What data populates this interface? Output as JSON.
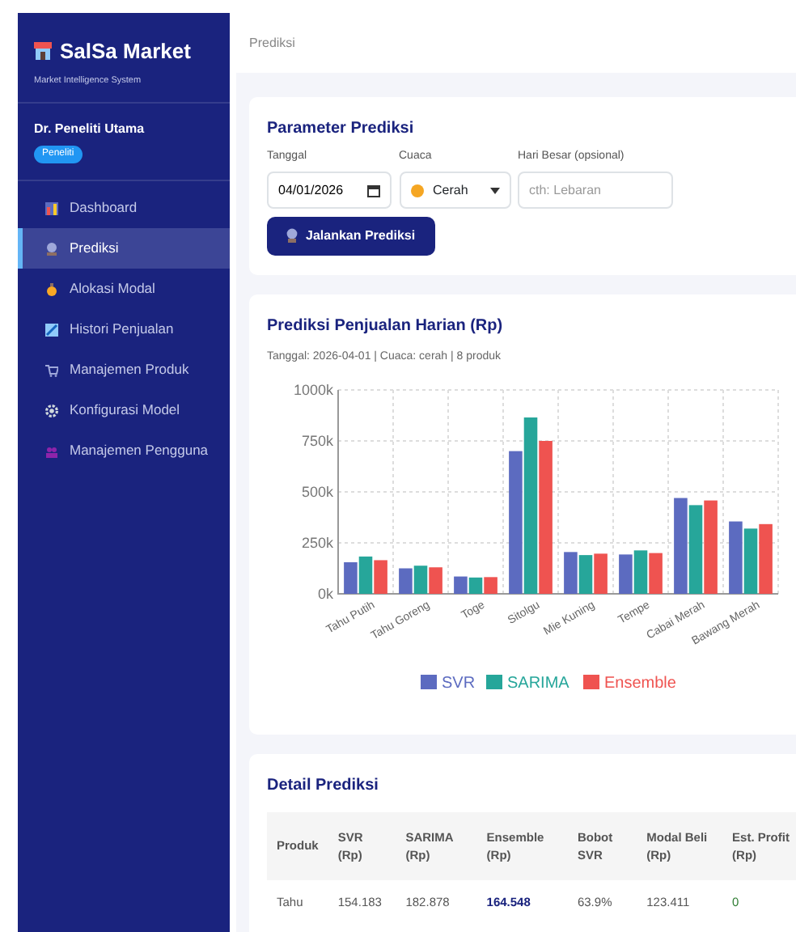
{
  "sidebar": {
    "brand": "SalSa Market",
    "tagline": "Market Intelligence System",
    "user": {
      "name": "Dr. Peneliti Utama",
      "role": "Peneliti"
    },
    "items": [
      {
        "label": "Dashboard",
        "selected": false
      },
      {
        "label": "Prediksi",
        "selected": true
      },
      {
        "label": "Alokasi Modal",
        "selected": false
      },
      {
        "label": "Histori Penjualan",
        "selected": false
      },
      {
        "label": "Manajemen Produk",
        "selected": false
      },
      {
        "label": "Konfigurasi Model",
        "selected": false
      },
      {
        "label": "Manajemen Pengguna",
        "selected": false
      }
    ]
  },
  "header": {
    "title": "Prediksi"
  },
  "parameters": {
    "title": "Parameter Prediksi",
    "date": {
      "label": "Tanggal",
      "value": "04/01/2026"
    },
    "weather": {
      "label": "Cuaca",
      "value": "Cerah"
    },
    "holiday": {
      "label": "Hari Besar (opsional)",
      "placeholder": "cth: Lebaran"
    },
    "button": "Jalankan Prediksi"
  },
  "forecast": {
    "title": "Prediksi Penjualan Harian (Rp)",
    "subtitle": "Tanggal: 2026-04-01 | Cuaca: cerah | 8 produk",
    "chart_data": {
      "type": "bar",
      "categories": [
        "Tahu Putih",
        "Tahu Goreng",
        "Toge",
        "Sitolgu",
        "Mie Kuning",
        "Tempe",
        "Cabai Merah",
        "Bawang Merah"
      ],
      "series": [
        {
          "name": "SVR",
          "color": "#5c6bc0",
          "values": [
            155000,
            125000,
            85000,
            700000,
            205000,
            193000,
            470000,
            355000
          ]
        },
        {
          "name": "SARIMA",
          "color": "#26a69a",
          "values": [
            183000,
            138000,
            80000,
            865000,
            190000,
            213000,
            435000,
            320000
          ]
        },
        {
          "name": "Ensemble",
          "color": "#ef5350",
          "values": [
            165000,
            130000,
            82000,
            750000,
            197000,
            200000,
            458000,
            342000
          ]
        }
      ],
      "grid": true,
      "legend": true,
      "ylim": [
        0,
        1000000
      ],
      "yticks": [
        {
          "value": 0,
          "label": "0k"
        },
        {
          "value": 250000,
          "label": "250k"
        },
        {
          "value": 500000,
          "label": "500k"
        },
        {
          "value": 750000,
          "label": "750k"
        },
        {
          "value": 1000000,
          "label": "1000k"
        }
      ]
    }
  },
  "details": {
    "title": "Detail Prediksi",
    "columns": [
      "Produk",
      "SVR (Rp)",
      "SARIMA (Rp)",
      "Ensemble (Rp)",
      "Bobot SVR",
      "Modal Beli (Rp)",
      "Est. Profit (Rp)"
    ],
    "rows": [
      {
        "cells": [
          "Tahu",
          "154.183",
          "182.878",
          "164.548",
          "63.9%",
          "123.411",
          "0"
        ]
      }
    ]
  }
}
